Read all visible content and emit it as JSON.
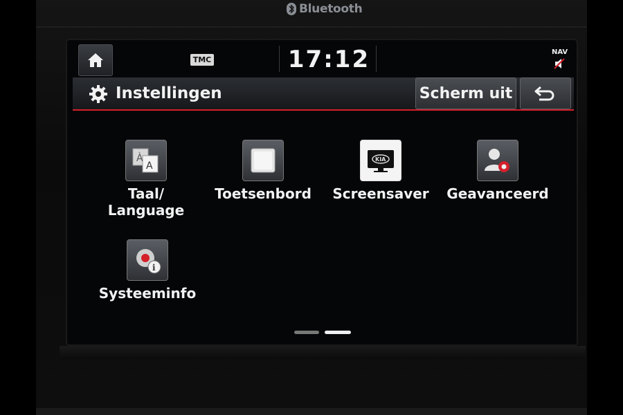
{
  "bezel": {
    "brand_text": "Bluetooth"
  },
  "status": {
    "tmc_label": "TMC",
    "time": "17:12",
    "nav_label": "NAV"
  },
  "header": {
    "title": "Instellingen",
    "screen_off_label": "Scherm uit"
  },
  "menu": {
    "items": [
      {
        "label_line1": "Taal/",
        "label_line2": "Language",
        "icon": "language-icon"
      },
      {
        "label": "Toetsenbord",
        "icon": "keyboard-icon"
      },
      {
        "label": "Screensaver",
        "icon": "screensaver-icon"
      },
      {
        "label": "Geavanceerd",
        "icon": "advanced-settings-icon"
      },
      {
        "label": "Systeeminfo",
        "icon": "system-info-icon"
      }
    ],
    "page_count": 2,
    "current_page": 2
  },
  "colors": {
    "accent": "#d4202a",
    "text": "#f2f2f2",
    "screen_bg": "#050608"
  }
}
